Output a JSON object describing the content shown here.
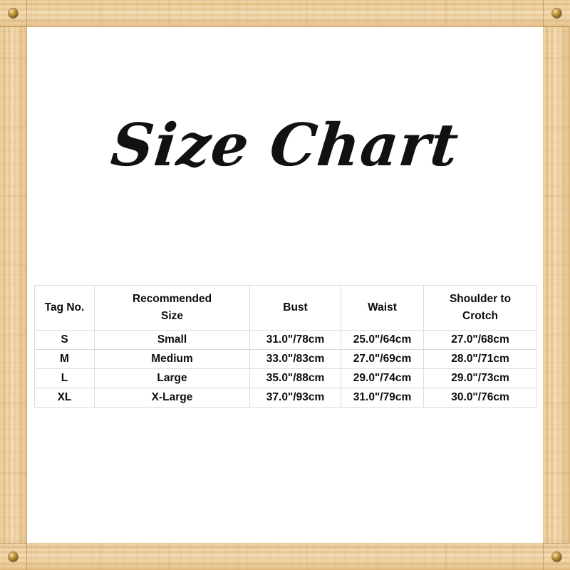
{
  "frame": {
    "material": "wood",
    "wood_color": "#e8c894",
    "stud_color": "#c79a40",
    "studs": [
      {
        "name": "corner-stud-top-left"
      },
      {
        "name": "corner-stud-top-right"
      },
      {
        "name": "corner-stud-bottom-left"
      },
      {
        "name": "corner-stud-bottom-right"
      }
    ]
  },
  "title": "Size Chart",
  "table": {
    "headers": [
      "Tag No.",
      "Recommended Size",
      "Bust",
      "Waist",
      "Shoulder to Crotch"
    ],
    "headers_split": [
      {
        "line1": "Tag No.",
        "line2": ""
      },
      {
        "line1": "Recommended",
        "line2": "Size"
      },
      {
        "line1": "Bust",
        "line2": ""
      },
      {
        "line1": "Waist",
        "line2": ""
      },
      {
        "line1": "Shoulder to",
        "line2": "Crotch"
      }
    ],
    "rows": [
      {
        "tag": "S",
        "recommended": "Small",
        "bust": "31.0\"/78cm",
        "waist": "25.0\"/64cm",
        "shoulder_to_crotch": "27.0\"/68cm"
      },
      {
        "tag": "M",
        "recommended": "Medium",
        "bust": "33.0\"/83cm",
        "waist": "27.0\"/69cm",
        "shoulder_to_crotch": "28.0\"/71cm"
      },
      {
        "tag": "L",
        "recommended": "Large",
        "bust": "35.0\"/88cm",
        "waist": "29.0\"/74cm",
        "shoulder_to_crotch": "29.0\"/73cm"
      },
      {
        "tag": "XL",
        "recommended": "X-Large",
        "bust": "37.0\"/93cm",
        "waist": "31.0\"/79cm",
        "shoulder_to_crotch": "30.0\"/76cm"
      }
    ],
    "grid_color": "#dcdcdc",
    "text_color": "#0d0d0d"
  }
}
